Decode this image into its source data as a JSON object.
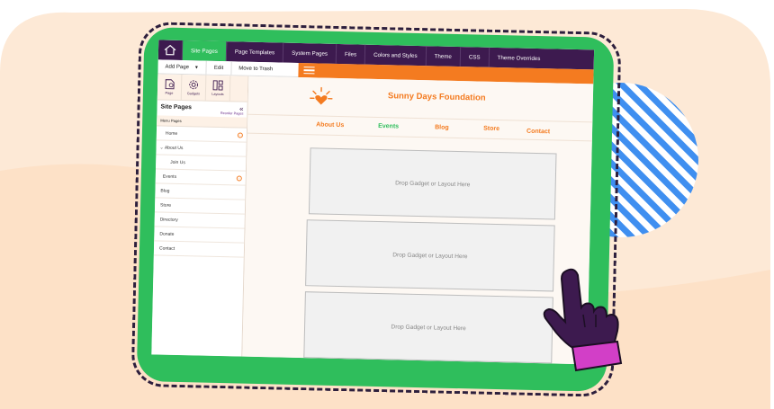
{
  "colors": {
    "purple": "#3d1a4f",
    "green": "#2fbe5c",
    "orange": "#f47b20",
    "peach": "#fde9d6",
    "blue": "#3f8ff0"
  },
  "topnav": {
    "home_icon": "home-icon",
    "tabs": [
      "Site Pages",
      "Page Templates",
      "System Pages",
      "Files",
      "Colors and Styles",
      "Theme",
      "CSS",
      "Theme Overrides"
    ]
  },
  "toolbar": {
    "add_page": "Add Page",
    "edit": "Edit",
    "move_to_trash": "Move to Trash",
    "menu_icon": "hamburger-icon"
  },
  "sidebar": {
    "icons": [
      {
        "label": "Page",
        "icon": "page-icon"
      },
      {
        "label": "Gadgets",
        "icon": "gear-icon"
      },
      {
        "label": "Layouts",
        "icon": "layout-icon"
      }
    ],
    "title": "Site Pages",
    "reorder_link": "Reorder Pages",
    "menu_label": "Menu Pages",
    "items": [
      "Home",
      "About Us",
      "Join Us",
      "Events",
      "Blog",
      "Store",
      "Directory",
      "Donate",
      "Contact"
    ]
  },
  "site": {
    "title": "Sunny Days Foundation",
    "logo_icon": "sun-heart-icon",
    "nav": [
      "About Us",
      "Events",
      "Blog",
      "Store",
      "Contact"
    ]
  },
  "drop_zones": [
    "Drop Gadget or Layout Here",
    "Drop Gadget or Layout Here",
    "Drop Gadget or Layout Here"
  ]
}
